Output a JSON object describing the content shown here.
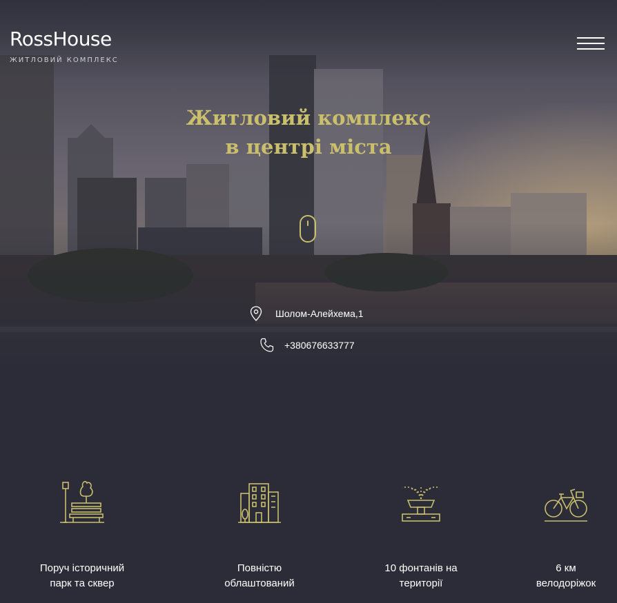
{
  "brand": {
    "name": "RossHouse",
    "tagline": "ЖИТЛОВИЙ КОМПЛЕКС"
  },
  "header": {
    "menu_icon": "hamburger-icon"
  },
  "hero": {
    "headline_line1": "Житловий комплекс",
    "headline_line2": "в центрі міста",
    "scroll_icon": "mouse-icon"
  },
  "contacts": {
    "address": "Шолом-Алейхема,1",
    "address_icon": "map-pin-icon",
    "phone": "+380676633777",
    "phone_icon": "phone-icon"
  },
  "features": [
    {
      "icon": "park-bench-icon",
      "line1": "Поруч історичний",
      "line2": "парк та сквер"
    },
    {
      "icon": "building-icon",
      "line1": "Повністю",
      "line2": "облаштований"
    },
    {
      "icon": "fountain-icon",
      "line1": "10 фонтанів на",
      "line2": "території"
    },
    {
      "icon": "bicycle-icon",
      "line1": "6 км",
      "line2": "велодоріжок"
    }
  ],
  "colors": {
    "background": "#2b2c37",
    "accent": "#c9bf6d",
    "text": "#ffffff"
  }
}
